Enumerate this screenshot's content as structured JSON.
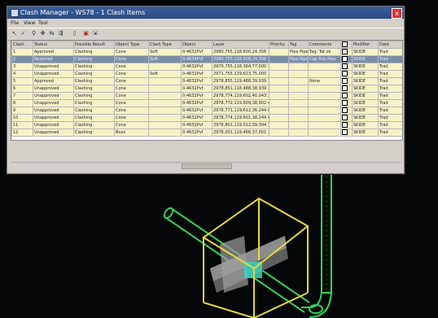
{
  "window": {
    "title": "Clash Manager - WS78 - 1 Clash Items",
    "close_glyph": "x",
    "menu": [
      "File",
      "View",
      "Tool"
    ]
  },
  "toolbar": {
    "icons": [
      "pointer-icon",
      "check-icon",
      "zoom-icon",
      "navigate-icon",
      "link-icon",
      "arrange-icon",
      "delete-icon",
      "report-icon",
      "export-icon"
    ]
  },
  "table": {
    "columns": [
      "Clash",
      "Status",
      "Possible Result",
      "Object Type",
      "Clash Type",
      "Object",
      "Layer",
      "Priority",
      "Tag",
      "Comments",
      "",
      "Modifier",
      "Date"
    ],
    "rows": [
      {
        "id": "1",
        "status": "Approved",
        "result": "Clashing",
        "otype": "Cone",
        "ctype": "Soft",
        "object": "0-4632Pvf",
        "layer": "2980,755,118,600,24,356 102",
        "priority": "",
        "tag": "Pipe Pipe",
        "comment": "Tag: Tat ok",
        "modifier": "SKIDE",
        "date": "Trad"
      },
      {
        "id": "2",
        "status": "Resolved",
        "result": "Clashing",
        "otype": "Cone",
        "ctype": "Soft",
        "object": "0-4634Pvf",
        "layer": "2980,755,118,608,24,356 102",
        "priority": "",
        "tag": "Pipe Pipe",
        "comment": "Cap Pub Plan",
        "modifier": "SKIDE",
        "date": "Trad"
      },
      {
        "id": "3",
        "status": "Unapproved",
        "result": "Clashing",
        "otype": "Cone",
        "ctype": "",
        "object": "0-4632Pvf",
        "layer": "2970,755,118,364,77,000 102",
        "priority": "",
        "tag": "",
        "comment": "",
        "modifier": "SKIDE",
        "date": "Trad"
      },
      {
        "id": "4",
        "status": "Unapproved",
        "result": "Clashing",
        "otype": "Cone",
        "ctype": "Soft",
        "object": "0-4632Pvf",
        "layer": "2971,755,119,623,75,000 102",
        "priority": "",
        "tag": "",
        "comment": "",
        "modifier": "SKIDE",
        "date": "Trad"
      },
      {
        "id": "5",
        "status": "Approved",
        "result": "Clashing",
        "otype": "Cone",
        "ctype": "",
        "object": "0-4632Pvf",
        "layer": "2978,855,119,488,39,939 1",
        "priority": "",
        "tag": "",
        "comment": "None",
        "modifier": "SKIDE",
        "date": "Trad"
      },
      {
        "id": "6",
        "status": "Unapproved",
        "result": "Clashing",
        "otype": "Cone",
        "ctype": "",
        "object": "0-4632Pvf",
        "layer": "2978,851,118,488,38,939 122",
        "priority": "",
        "tag": "",
        "comment": "",
        "modifier": "SKIDE",
        "date": "Trad"
      },
      {
        "id": "7",
        "status": "Unapproved",
        "result": "Clashing",
        "otype": "Cone",
        "ctype": "",
        "object": "0-4632Pvf",
        "layer": "2978,774,119,602,40,043 122",
        "priority": "",
        "tag": "",
        "comment": "",
        "modifier": "SKIDE",
        "date": "Trad"
      },
      {
        "id": "8",
        "status": "Unapproved",
        "result": "Clashing",
        "otype": "Cone",
        "ctype": "",
        "object": "0-4632Pvf",
        "layer": "2978,772,119,609,38,902 427",
        "priority": "",
        "tag": "",
        "comment": "",
        "modifier": "SKIDE",
        "date": "Trad"
      },
      {
        "id": "9",
        "status": "Unapproved",
        "result": "Clashing",
        "otype": "Cone",
        "ctype": "",
        "object": "0-4632Pvf",
        "layer": "2978,771,119,612,36,244 002",
        "priority": "",
        "tag": "",
        "comment": "",
        "modifier": "SKIDE",
        "date": "Trad"
      },
      {
        "id": "10",
        "status": "Unapproved",
        "result": "Clashing",
        "otype": "Cone",
        "ctype": "",
        "object": "0-4632Pvf",
        "layer": "2978,774,119,601,38,244 668",
        "priority": "",
        "tag": "",
        "comment": "",
        "modifier": "SKIDE",
        "date": "Trad"
      },
      {
        "id": "11",
        "status": "Unapproved",
        "result": "Clashing",
        "otype": "Cone",
        "ctype": "",
        "object": "0-4632Pvf",
        "layer": "2978,801,119,512,39,304 102",
        "priority": "",
        "tag": "",
        "comment": "",
        "modifier": "SKIDE",
        "date": "Trad"
      },
      {
        "id": "12",
        "status": "Unapproved",
        "result": "Clashing",
        "otype": "Boxx",
        "ctype": "",
        "object": "0-4632Pvf",
        "layer": "2978,001,119,466,37,001 102",
        "priority": "",
        "tag": "",
        "comment": "",
        "modifier": "SKIDE",
        "date": "Trad"
      }
    ]
  },
  "colors": {
    "accent": "#274a86",
    "row_fill": "#f6f2c8",
    "selected_row": "#7b8ea8",
    "pipe_green": "#2fd35a",
    "clash_box": "#e6d93a",
    "clash_highlight": "#3ad3c0"
  }
}
